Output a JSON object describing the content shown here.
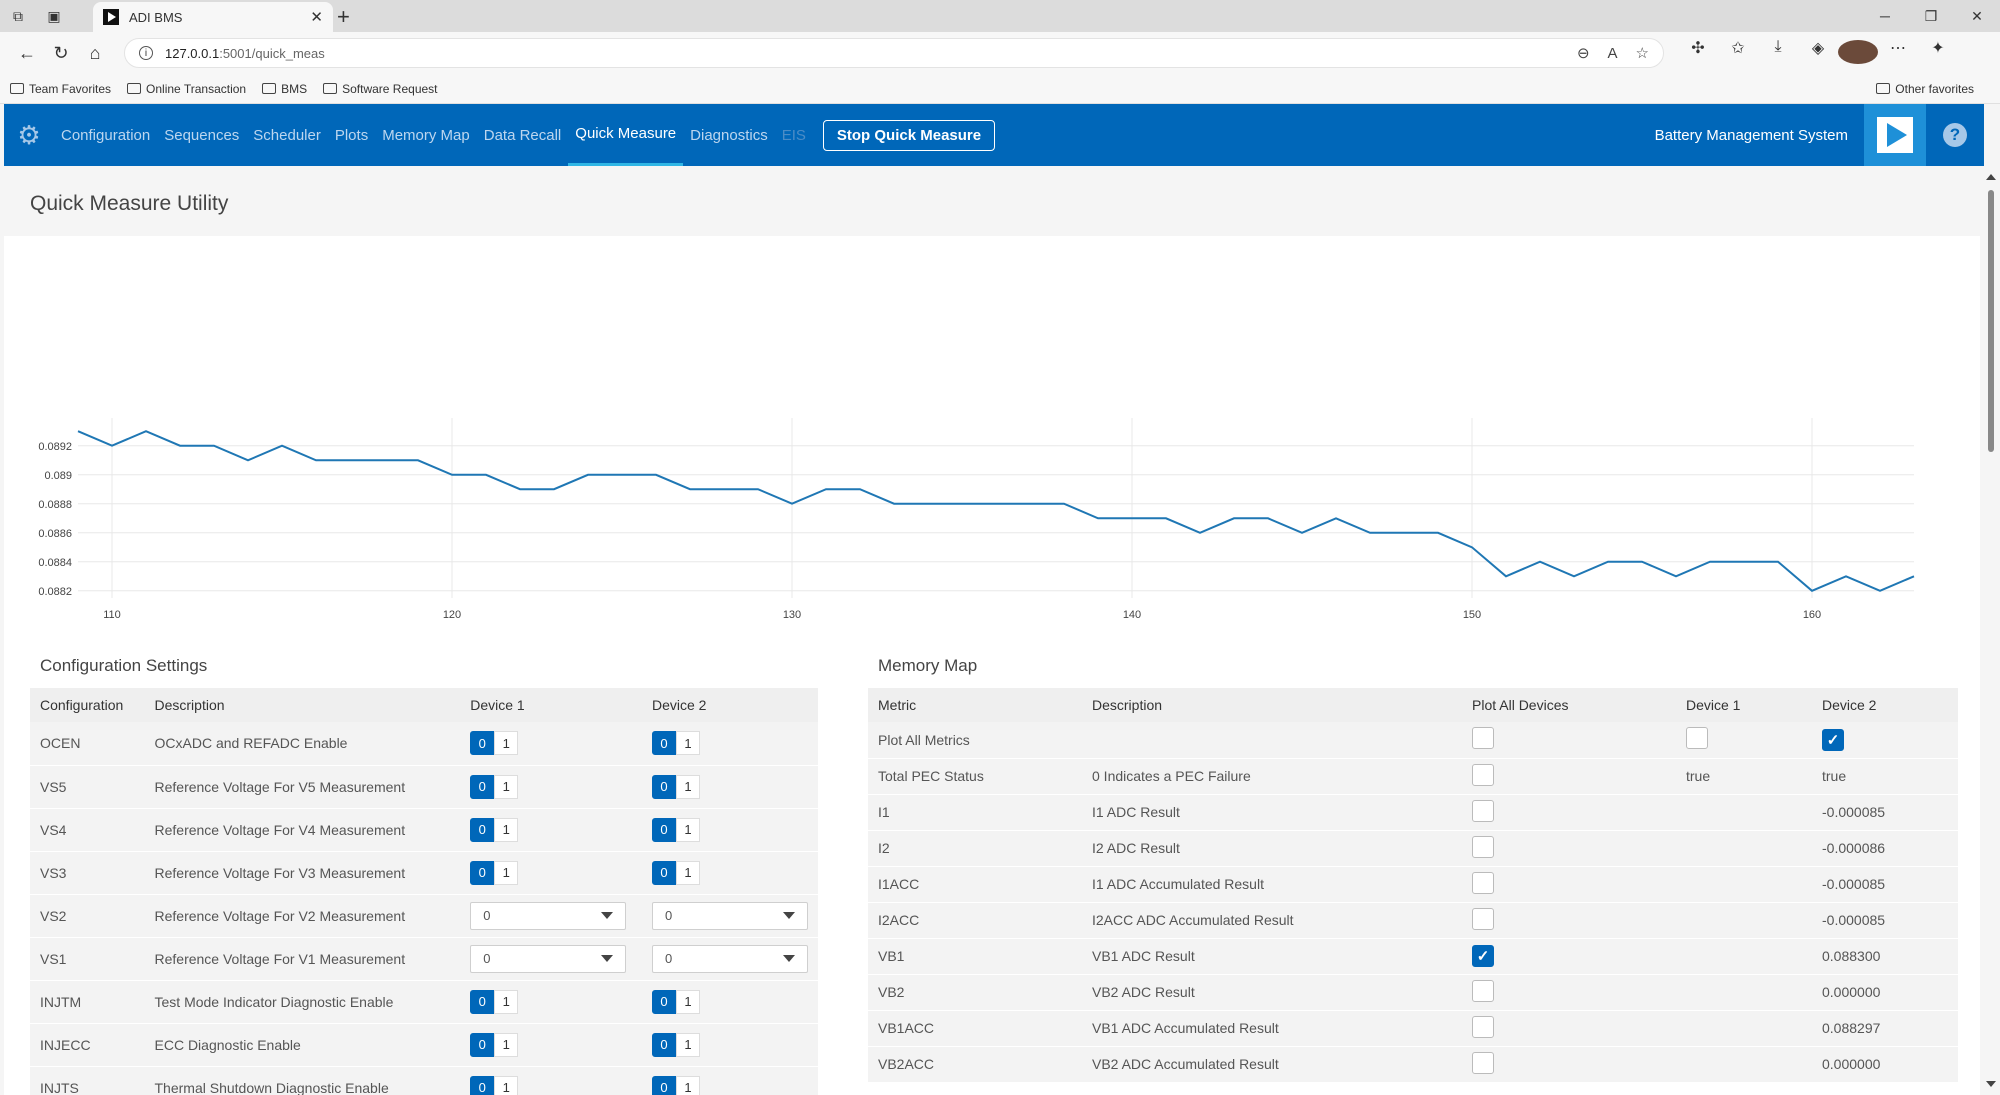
{
  "browser": {
    "tab_title": "ADI BMS",
    "url_host": "127.0.0.1",
    "url_path": ":5001/quick_meas",
    "favorites": [
      "Team Favorites",
      "Online Transaction",
      "BMS",
      "Software Request"
    ],
    "other_favorites": "Other favorites"
  },
  "nav": {
    "links": [
      "Configuration",
      "Sequences",
      "Scheduler",
      "Plots",
      "Memory Map",
      "Data Recall",
      "Quick Measure",
      "Diagnostics",
      "EIS"
    ],
    "active": "Quick Measure",
    "stop_button": "Stop Quick Measure",
    "system_name": "Battery Management System",
    "help": "?"
  },
  "page": {
    "title": "Quick Measure Utility"
  },
  "chart_data": {
    "type": "line",
    "x": [
      109,
      110,
      111,
      112,
      113,
      114,
      115,
      116,
      117,
      118,
      119,
      120,
      121,
      122,
      123,
      124,
      125,
      126,
      127,
      128,
      129,
      130,
      131,
      132,
      133,
      134,
      135,
      136,
      137,
      138,
      139,
      140,
      141,
      142,
      143,
      144,
      145,
      146,
      147,
      148,
      149,
      150,
      151,
      152,
      153,
      154,
      155,
      156,
      157,
      158,
      159,
      160,
      161,
      162,
      163
    ],
    "y": [
      0.0893,
      0.0892,
      0.0893,
      0.0892,
      0.0892,
      0.0891,
      0.0892,
      0.0891,
      0.0891,
      0.0891,
      0.0891,
      0.089,
      0.089,
      0.0889,
      0.0889,
      0.089,
      0.089,
      0.089,
      0.0889,
      0.0889,
      0.0889,
      0.0888,
      0.0889,
      0.0889,
      0.0888,
      0.0888,
      0.0888,
      0.0888,
      0.0888,
      0.0888,
      0.0887,
      0.0887,
      0.0887,
      0.0886,
      0.0887,
      0.0887,
      0.0886,
      0.0887,
      0.0886,
      0.0886,
      0.0886,
      0.0885,
      0.0883,
      0.0884,
      0.0883,
      0.0884,
      0.0884,
      0.0883,
      0.0884,
      0.0884,
      0.0884,
      0.0882,
      0.0883,
      0.0882,
      0.0883
    ],
    "x_ticks": [
      110,
      120,
      130,
      140,
      150,
      160
    ],
    "y_ticks": [
      0.0882,
      0.0884,
      0.0886,
      0.0888,
      0.089,
      0.0892
    ],
    "xlim": [
      109,
      163
    ],
    "ylim": [
      0.08815,
      0.08935
    ],
    "line_color": "#1f77b4",
    "grid": true
  },
  "config_settings": {
    "title": "Configuration Settings",
    "headers": [
      "Configuration",
      "Description",
      "Device 1",
      "Device 2"
    ],
    "rows": [
      {
        "name": "OCEN",
        "desc": "OCxADC and REFADC Enable",
        "type": "toggle",
        "d1": "0",
        "d2": "0"
      },
      {
        "name": "VS5",
        "desc": "Reference Voltage For V5 Measurement",
        "type": "toggle",
        "d1": "0",
        "d2": "0"
      },
      {
        "name": "VS4",
        "desc": "Reference Voltage For V4 Measurement",
        "type": "toggle",
        "d1": "0",
        "d2": "0"
      },
      {
        "name": "VS3",
        "desc": "Reference Voltage For V3 Measurement",
        "type": "toggle",
        "d1": "0",
        "d2": "0"
      },
      {
        "name": "VS2",
        "desc": "Reference Voltage For V2 Measurement",
        "type": "select",
        "d1": "0",
        "d2": "0"
      },
      {
        "name": "VS1",
        "desc": "Reference Voltage For V1 Measurement",
        "type": "select",
        "d1": "0",
        "d2": "0"
      },
      {
        "name": "INJTM",
        "desc": "Test Mode Indicator Diagnostic Enable",
        "type": "toggle",
        "d1": "0",
        "d2": "0"
      },
      {
        "name": "INJECC",
        "desc": "ECC Diagnostic Enable",
        "type": "toggle",
        "d1": "0",
        "d2": "0"
      },
      {
        "name": "INJTS",
        "desc": "Thermal Shutdown Diagnostic Enable",
        "type": "toggle",
        "d1": "0",
        "d2": "0"
      }
    ]
  },
  "memory_map": {
    "title": "Memory Map",
    "headers": [
      "Metric",
      "Description",
      "Plot All Devices",
      "Device 1",
      "Device 2"
    ],
    "rows": [
      {
        "metric": "Plot All Metrics",
        "desc": "",
        "plot": false,
        "d1": "checkbox:false",
        "d2": "checkbox:true"
      },
      {
        "metric": "Total PEC Status",
        "desc": "0 Indicates a PEC Failure",
        "plot": false,
        "d1": "true",
        "d2": "true"
      },
      {
        "metric": "I1",
        "desc": "I1 ADC Result",
        "plot": false,
        "d1": "",
        "d2": "-0.000085"
      },
      {
        "metric": "I2",
        "desc": "I2 ADC Result",
        "plot": false,
        "d1": "",
        "d2": "-0.000086"
      },
      {
        "metric": "I1ACC",
        "desc": "I1 ADC Accumulated Result",
        "plot": false,
        "d1": "",
        "d2": "-0.000085"
      },
      {
        "metric": "I2ACC",
        "desc": "I2ACC ADC Accumulated Result",
        "plot": false,
        "d1": "",
        "d2": "-0.000085"
      },
      {
        "metric": "VB1",
        "desc": "VB1 ADC Result",
        "plot": true,
        "d1": "",
        "d2": "0.088300"
      },
      {
        "metric": "VB2",
        "desc": "VB2 ADC Result",
        "plot": false,
        "d1": "",
        "d2": "0.000000"
      },
      {
        "metric": "VB1ACC",
        "desc": "VB1 ADC Accumulated Result",
        "plot": false,
        "d1": "",
        "d2": "0.088297"
      },
      {
        "metric": "VB2ACC",
        "desc": "VB2 ADC Accumulated Result",
        "plot": false,
        "d1": "",
        "d2": "0.000000"
      }
    ]
  }
}
